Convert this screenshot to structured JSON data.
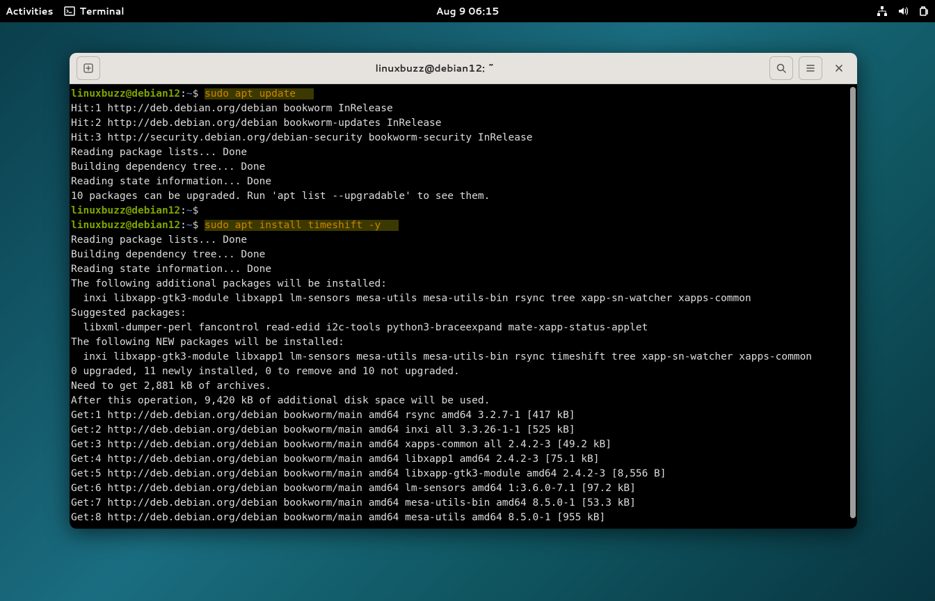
{
  "topbar": {
    "activities": "Activities",
    "app_name": "Terminal",
    "clock": "Aug 9  06:15"
  },
  "window": {
    "title": "linuxbuzz@debian12: ~"
  },
  "prompt": {
    "user_host": "linuxbuzz@debian12",
    "colon": ":",
    "path": "~",
    "dollar": "$"
  },
  "commands": {
    "cmd1": "sudo apt update",
    "cmd2": "sudo apt install timeshift -y"
  },
  "output1": [
    "Hit:1 http://deb.debian.org/debian bookworm InRelease",
    "Hit:2 http://deb.debian.org/debian bookworm-updates InRelease",
    "Hit:3 http://security.debian.org/debian-security bookworm-security InRelease",
    "Reading package lists... Done",
    "Building dependency tree... Done",
    "Reading state information... Done",
    "10 packages can be upgraded. Run 'apt list --upgradable' to see them."
  ],
  "output2": [
    "Reading package lists... Done",
    "Building dependency tree... Done",
    "Reading state information... Done",
    "The following additional packages will be installed:",
    "  inxi libxapp-gtk3-module libxapp1 lm-sensors mesa-utils mesa-utils-bin rsync tree xapp-sn-watcher xapps-common",
    "Suggested packages:",
    "  libxml-dumper-perl fancontrol read-edid i2c-tools python3-braceexpand mate-xapp-status-applet",
    "The following NEW packages will be installed:",
    "  inxi libxapp-gtk3-module libxapp1 lm-sensors mesa-utils mesa-utils-bin rsync timeshift tree xapp-sn-watcher xapps-common",
    "0 upgraded, 11 newly installed, 0 to remove and 10 not upgraded.",
    "Need to get 2,881 kB of archives.",
    "After this operation, 9,420 kB of additional disk space will be used.",
    "Get:1 http://deb.debian.org/debian bookworm/main amd64 rsync amd64 3.2.7-1 [417 kB]",
    "Get:2 http://deb.debian.org/debian bookworm/main amd64 inxi all 3.3.26-1-1 [525 kB]",
    "Get:3 http://deb.debian.org/debian bookworm/main amd64 xapps-common all 2.4.2-3 [49.2 kB]",
    "Get:4 http://deb.debian.org/debian bookworm/main amd64 libxapp1 amd64 2.4.2-3 [75.1 kB]",
    "Get:5 http://deb.debian.org/debian bookworm/main amd64 libxapp-gtk3-module amd64 2.4.2-3 [8,556 B]",
    "Get:6 http://deb.debian.org/debian bookworm/main amd64 lm-sensors amd64 1:3.6.0-7.1 [97.2 kB]",
    "Get:7 http://deb.debian.org/debian bookworm/main amd64 mesa-utils-bin amd64 8.5.0-1 [53.3 kB]",
    "Get:8 http://deb.debian.org/debian bookworm/main amd64 mesa-utils amd64 8.5.0-1 [955 kB]"
  ]
}
